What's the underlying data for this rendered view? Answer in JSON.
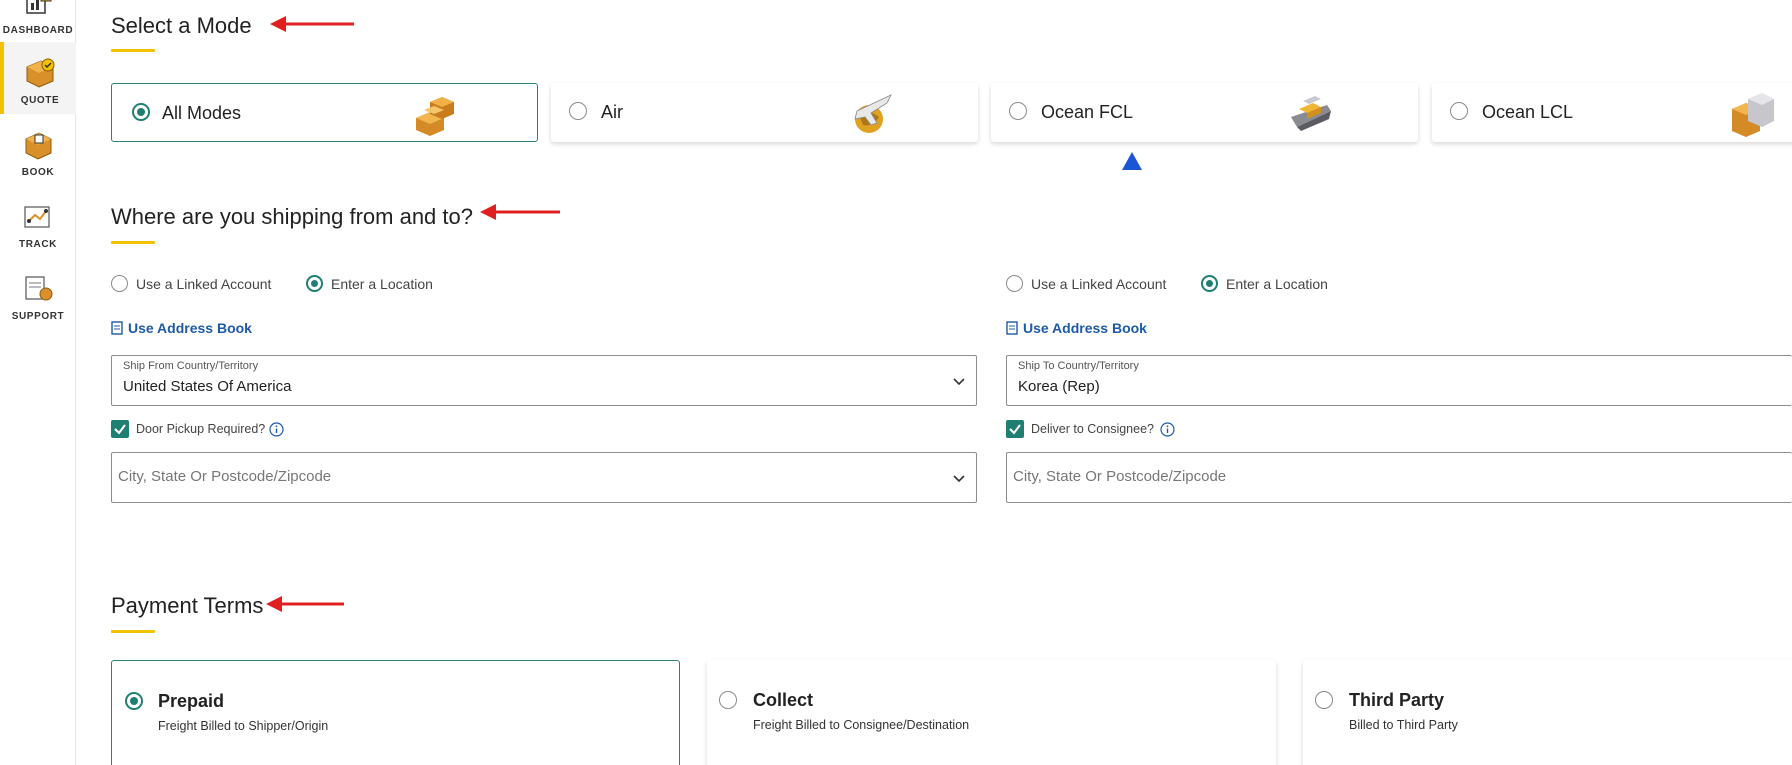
{
  "sidebar": {
    "items": [
      {
        "label": "DASHBOARD",
        "icon": "dashboard-icon",
        "active": false
      },
      {
        "label": "QUOTE",
        "icon": "quote-icon",
        "active": true
      },
      {
        "label": "BOOK",
        "icon": "book-icon",
        "active": false
      },
      {
        "label": "TRACK",
        "icon": "track-icon",
        "active": false
      },
      {
        "label": "SUPPORT",
        "icon": "support-icon",
        "active": false
      }
    ]
  },
  "mode": {
    "title": "Select a Mode",
    "options": [
      {
        "label": "All Modes",
        "selected": true,
        "icon": "boxes-icon"
      },
      {
        "label": "Air",
        "selected": false,
        "icon": "plane-globe-icon"
      },
      {
        "label": "Ocean FCL",
        "selected": false,
        "icon": "ship-icon"
      },
      {
        "label": "Ocean LCL",
        "selected": false,
        "icon": "containers-icon"
      }
    ]
  },
  "shipping": {
    "title": "Where are you shipping from and to?",
    "from": {
      "linked_account_label": "Use a Linked Account",
      "enter_location_label": "Enter a Location",
      "address_book_label": "Use Address Book",
      "country_label": "Ship From Country/Territory",
      "country_value": "United States Of America",
      "checkbox_label": "Door Pickup Required?",
      "city_placeholder": "City, State Or Postcode/Zipcode"
    },
    "to": {
      "linked_account_label": "Use a Linked Account",
      "enter_location_label": "Enter a Location",
      "address_book_label": "Use Address Book",
      "country_label": "Ship To Country/Territory",
      "country_value": "Korea (Rep)",
      "checkbox_label": "Deliver to Consignee?",
      "city_placeholder": "City, State Or Postcode/Zipcode"
    }
  },
  "payment": {
    "title": "Payment Terms",
    "options": [
      {
        "label": "Prepaid",
        "sub": "Freight Billed to Shipper/Origin",
        "selected": true
      },
      {
        "label": "Collect",
        "sub": "Freight Billed to Consignee/Destination",
        "selected": false
      },
      {
        "label": "Third Party",
        "sub": "Billed to Third Party",
        "selected": false
      }
    ]
  },
  "colors": {
    "accent": "#1f7f73",
    "underline": "#f2c200",
    "link": "#1d5aa8",
    "annotation_arrow": "#e02020",
    "annotation_marker": "#1a55d6"
  }
}
